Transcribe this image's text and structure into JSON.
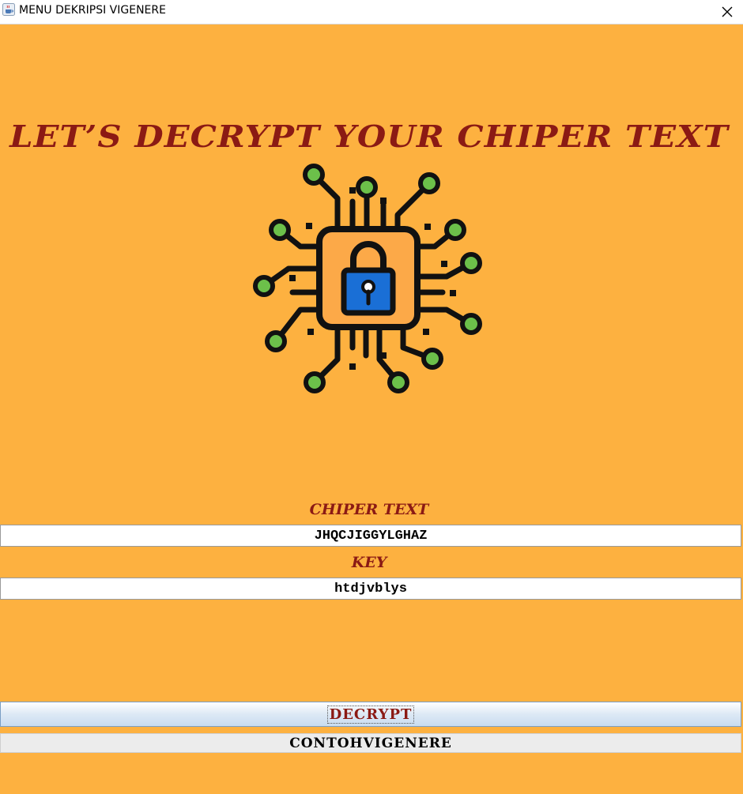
{
  "window": {
    "title": "MENU DEKRIPSI VIGENERE",
    "app_icon": "java-coffee-icon",
    "close_icon": "close-icon"
  },
  "main": {
    "heading": "LET’S DECRYPT YOUR CHIPER TEXT",
    "logo_icon": "circuit-lock-icon",
    "cipher_label": "CHIPER TEXT",
    "cipher_value": "JHQCJIGGYLGHAZ",
    "key_label": "KEY",
    "key_value": "htdjvblys",
    "decrypt_label": "DECRYPT",
    "example_label": "CONTOHVIGENERE"
  },
  "colors": {
    "background": "#fdb140",
    "heading": "#8b1a14",
    "chip_outline": "#111111",
    "chip_fill": "#fca948",
    "lock_blue": "#1a6fd6",
    "node_green": "#6cc04a"
  }
}
